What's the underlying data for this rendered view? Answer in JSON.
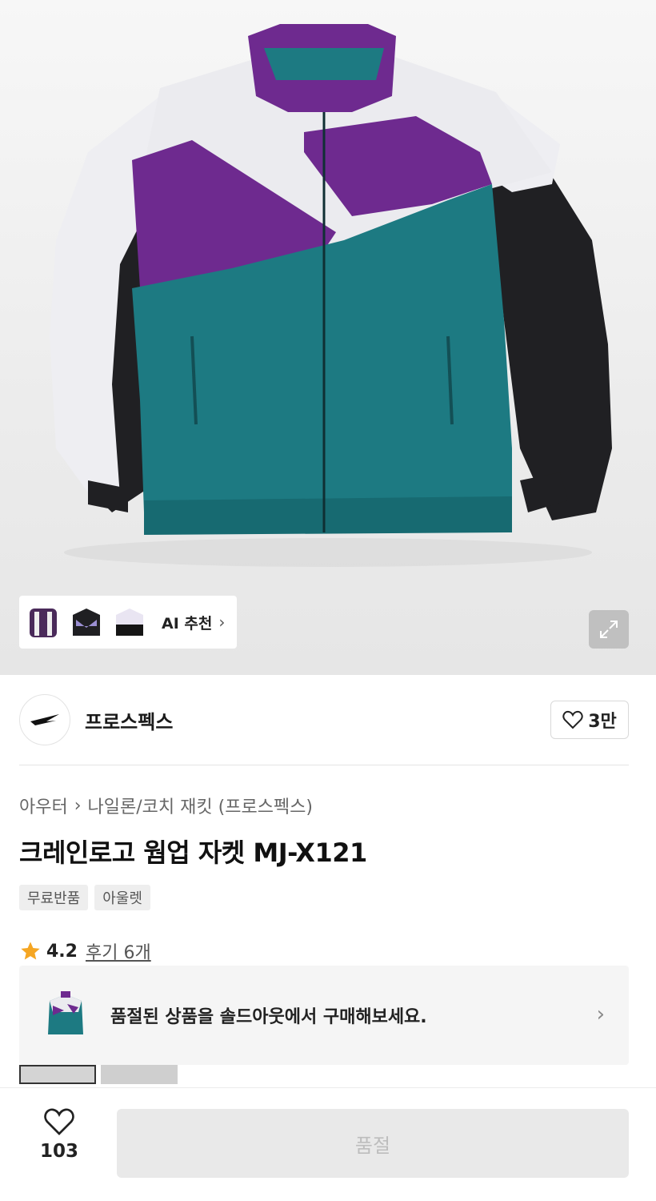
{
  "hero": {
    "ai_label": "AI 추천",
    "ai_chevron": "›",
    "expand_icon": "expand-icon"
  },
  "brand": {
    "name": "프로스펙스",
    "like_count": "3만"
  },
  "breadcrumb": {
    "category": "아우터",
    "separator": "›",
    "subcategory": "나일론/코치 재킷 (프로스펙스)"
  },
  "product": {
    "title": "크레인로고 웜업 자켓 MJ-X121",
    "tags": [
      "무료반품",
      "아울렛"
    ],
    "rating": "4.2",
    "review_link": "후기 6개"
  },
  "soldout_banner": {
    "text": "품절된 상품을 솔드아웃에서 구매해보세요.",
    "chevron": "›"
  },
  "bottom_bar": {
    "wish_count": "103",
    "buy_label": "품절"
  },
  "colors": {
    "purple": "#6e2a8f",
    "teal": "#1d7a82",
    "white_panel": "#e9e9ee",
    "black_panel": "#1f1f22",
    "star": "#f5a623"
  }
}
